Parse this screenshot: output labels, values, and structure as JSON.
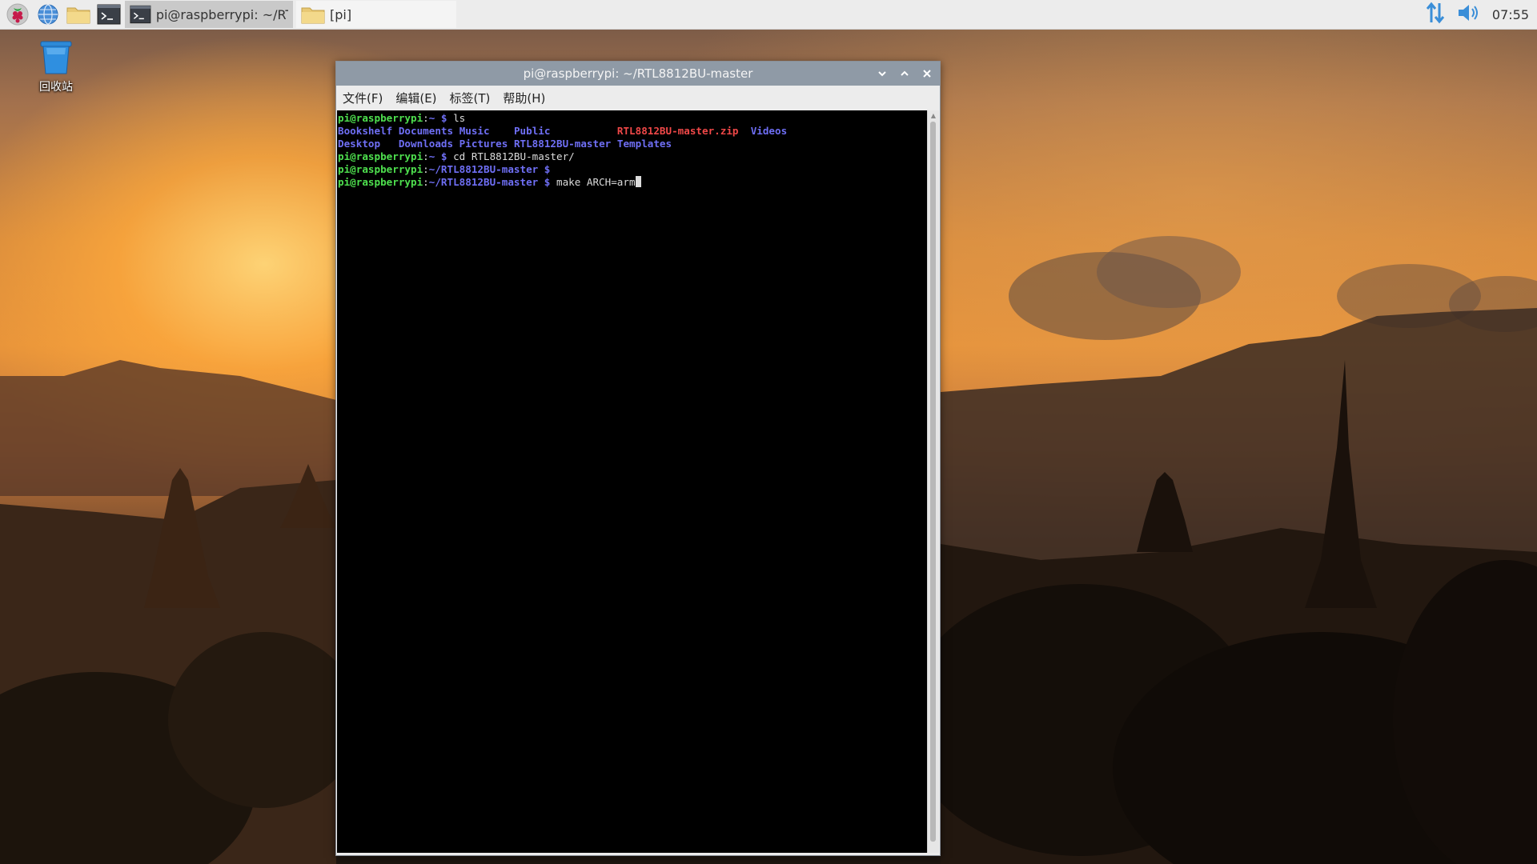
{
  "taskbar": {
    "tasks": [
      {
        "label": "pi@raspberrypi: ~/RT...",
        "state": "active"
      },
      {
        "label": "[pi]",
        "state": "inactive"
      }
    ],
    "clock": "07:55"
  },
  "desktop": {
    "trash_label": "回收站"
  },
  "window": {
    "title": "pi@raspberrypi: ~/RTL8812BU-master",
    "menu": [
      "文件(F)",
      "编辑(E)",
      "标签(T)",
      "帮助(H)"
    ]
  },
  "terminal": {
    "prompt_user": "pi@raspberrypi",
    "lines": [
      {
        "path": "~",
        "suffix": " $ ",
        "command": "ls"
      },
      {
        "listing": [
          "Bookshelf",
          "Documents",
          "Music",
          "Public",
          "RTL8812BU-master.zip",
          "Videos"
        ]
      },
      {
        "listing": [
          "Desktop",
          "Downloads",
          "Pictures",
          "RTL8812BU-master",
          "Templates"
        ]
      },
      {
        "path": "~",
        "suffix": " $ ",
        "command": "cd RTL8812BU-master/"
      },
      {
        "path": "~/RTL8812BU-master",
        "suffix": " $",
        "command": ""
      },
      {
        "path": "~/RTL8812BU-master",
        "suffix": " $ ",
        "command": "make ARCH=arm"
      }
    ]
  },
  "colors": {
    "prompt_user": "#4ee04e",
    "directory": "#6f6ff5",
    "archive": "#f04848",
    "titlebar": "#8f9aa6",
    "terminal_bg": "#000000"
  }
}
